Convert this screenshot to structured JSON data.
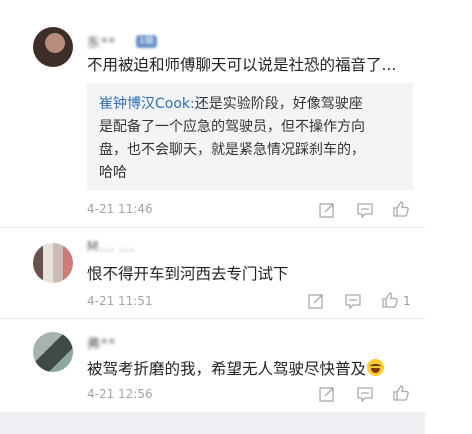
{
  "comments": [
    {
      "username": "东**",
      "badge": "1级",
      "text": "不用被迫和师傅聊天可以说是社恐的福音了...",
      "reply": {
        "name": "崔钟博汉Cook:",
        "lines": [
          "还是实验阶段，好像驾驶座",
          "是配备了一个应急的驾驶员，但不操作方向",
          "盘，也不会聊天，就是紧急情况踩刹车的，",
          "哈哈"
        ]
      },
      "time": "4-21 11:46",
      "likes": ""
    },
    {
      "username": "M... ...",
      "text": "恨不得开车到河西去专门试下",
      "time": "4-21 11:51",
      "likes": "1"
    },
    {
      "username": "弗**",
      "text": "被驾考折磨的我，希望无人驾驶尽快普及",
      "time": "4-21 12:56",
      "likes": ""
    }
  ],
  "icons": {
    "share": "share-icon",
    "comment": "comment-icon",
    "like": "thumbs-up-icon"
  }
}
